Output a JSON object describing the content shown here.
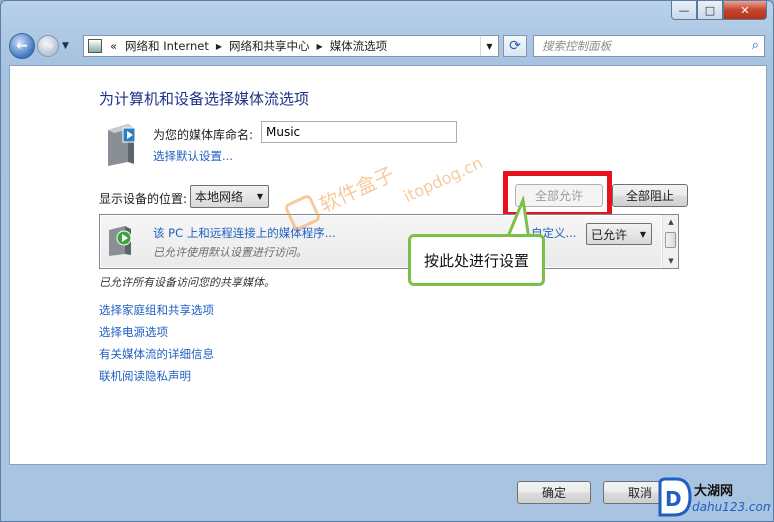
{
  "window": {
    "controls": {
      "minimize": "—",
      "maximize": "□",
      "close": "✕"
    }
  },
  "nav": {
    "back_icon": "back-arrow-icon",
    "forward_icon": "forward-arrow-icon",
    "address": {
      "prefix": "«",
      "segments": [
        "网络和 Internet",
        "网络和共享中心",
        "媒体流选项"
      ]
    },
    "search_placeholder": "搜索控制面板"
  },
  "main": {
    "title": "为计算机和设备选择媒体流选项",
    "library_label": "为您的媒体库命名:",
    "library_value": "Music",
    "choose_defaults": "选择默认设置...",
    "location_label": "显示设备的位置:",
    "location_value": "本地网络",
    "allow_all": "全部允许",
    "block_all": "全部阻止",
    "program": {
      "title": "该 PC 上和远程连接上的媒体程序...",
      "desc": "已允许使用默认设置进行访问。",
      "custom": "自定义...",
      "status_value": "已允许"
    },
    "status_text": "已允许所有设备访问您的共享媒体。",
    "links": [
      "选择家庭组和共享选项",
      "选择电源选项",
      "有关媒体流的详细信息",
      "联机阅读隐私声明"
    ]
  },
  "callout": {
    "text": "按此处进行设置",
    "color": "#7cc04a",
    "highlight_color": "#e8121d"
  },
  "watermark": {
    "line1": "软件盒子",
    "line2": "itopdog.cn"
  },
  "footer": {
    "ok": "确定",
    "cancel": "取消"
  },
  "logo": {
    "brand": "大湖网",
    "site": "dahu123.com",
    "letter": "D"
  }
}
